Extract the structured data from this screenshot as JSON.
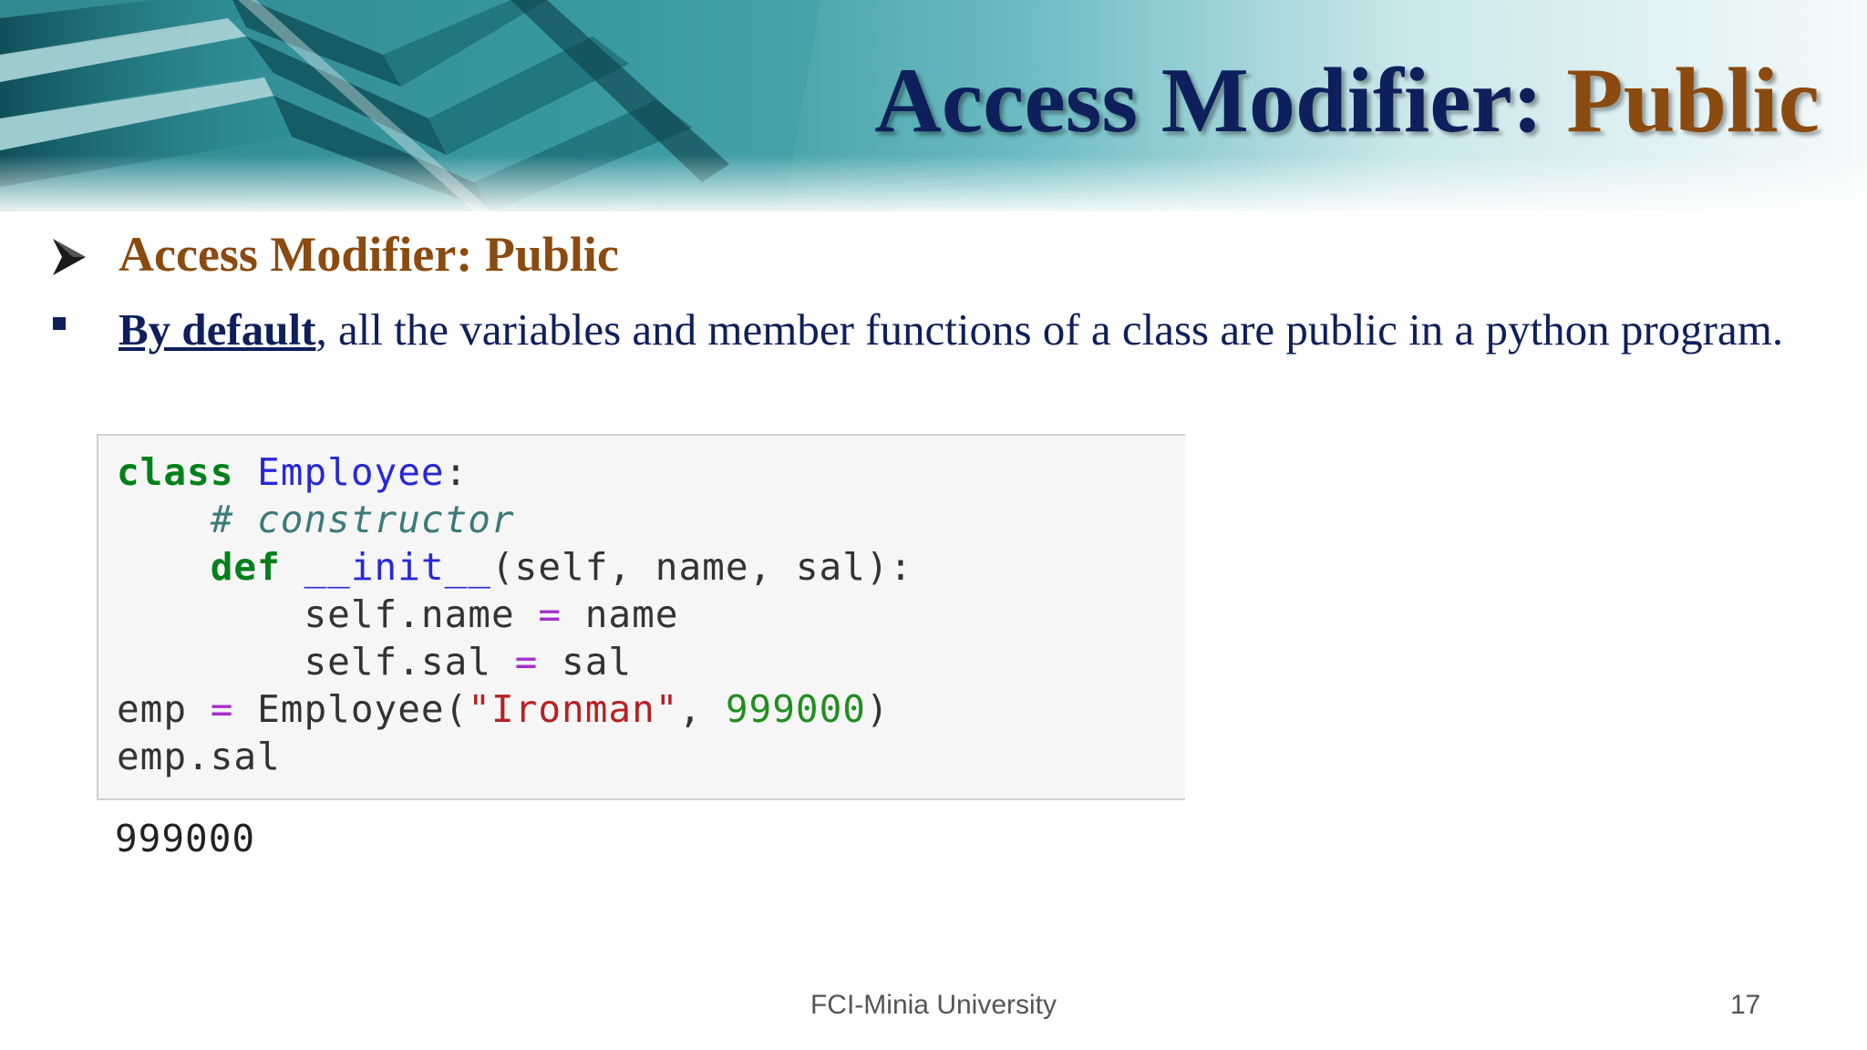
{
  "slide": {
    "title_main": "Access Modifier: ",
    "title_accent": "Public",
    "heading": "Access Modifier: Public",
    "bullet_bold": "By default",
    "bullet_rest": ", all the variables and member functions of a class are public in a python program.",
    "colors": {
      "title": "#0e1f5c",
      "accent": "#8b4a0f",
      "banner": "#2e8f97"
    }
  },
  "code": {
    "line1_kw": "class",
    "line1_name": "Employee",
    "line1_end": ":",
    "line2_comment": "# constructor",
    "line3_kw": "def",
    "line3_fn": "__init__",
    "line3_args": "(self, name, sal):",
    "line4_lhs": "self.name",
    "line4_op": "=",
    "line4_rhs": "name",
    "line5_lhs": "self.sal",
    "line5_op": "=",
    "line5_rhs": "sal",
    "line6_lhs": "emp",
    "line6_op": "=",
    "line6_call": "Employee(",
    "line6_str": "\"Ironman\"",
    "line6_sep": ", ",
    "line6_num": "999000",
    "line6_end": ")",
    "line7": "emp.sal",
    "output": "999000"
  },
  "footer": {
    "text": "FCI-Minia University",
    "page": "17"
  }
}
